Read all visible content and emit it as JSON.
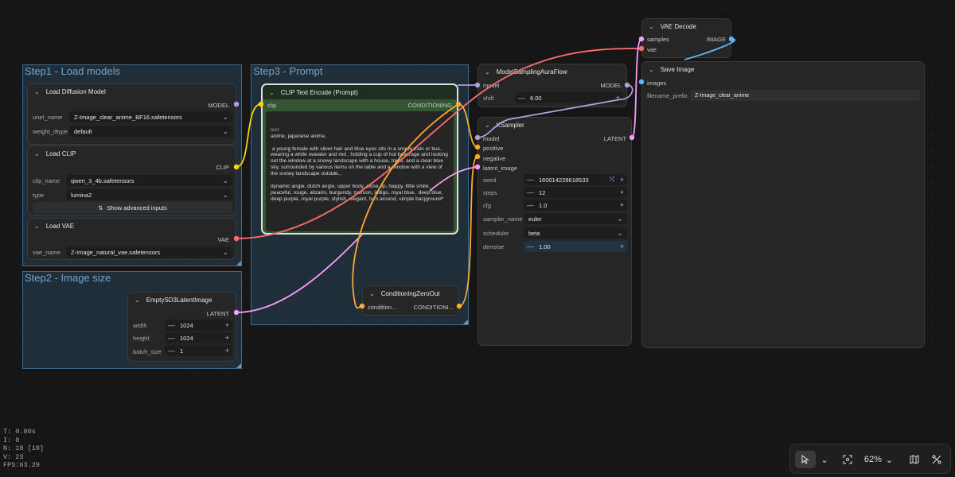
{
  "groups": {
    "step1": "Step1 - Load models",
    "step2": "Step2 - Image size",
    "step3": "Step3 - Prompt"
  },
  "load_diffusion": {
    "title": "Load Diffusion Model",
    "output": "MODEL",
    "unet_label": "unet_name",
    "unet_value": "Z-Image_clear_anime_BF16.safetensors",
    "dtype_label": "weight_dtype",
    "dtype_value": "default"
  },
  "load_clip": {
    "title": "Load CLIP",
    "output": "CLIP",
    "name_label": "clip_name",
    "name_value": "qwen_3_4b.safetensors",
    "type_label": "type",
    "type_value": "lumina2",
    "advanced": "Show advanced inputs"
  },
  "load_vae": {
    "title": "Load VAE",
    "output": "VAE",
    "name_label": "vae_name",
    "name_value": "Z-Image_natural_vae.safetensors"
  },
  "empty_latent": {
    "title": "EmptySD3LatentImage",
    "output": "LATENT",
    "width_label": "width",
    "width_value": "1024",
    "height_label": "height",
    "height_value": "1024",
    "batch_label": "batch_size",
    "batch_value": "1"
  },
  "clip_encode": {
    "title": "CLIP Text Encode (Prompt)",
    "input": "clip",
    "output": "CONDITIONING",
    "text_label": "text",
    "text": "anime, japanese anime,\n\n a young female with silver hair and blue eyes sits in a snowy train or bus, wearing a white sweater and red , holding a cup of hot beverage and looking out the window at a snowy landscape with a house, trees, and a clear blue sky, surrounded by various items on the table and a window with a view of the snowy landscape outside.,\n\ndynamic angle, dutch angle, upper body, close up, happy, little smile, peaceful, rouge, alizarin, burgundy, maroon, indigo, royal blue,  deep blue, deep purple, royal purple, stylish, elegant, turn around, simple bacjground*"
  },
  "cond_zero": {
    "title": "ConditioningZeroOut",
    "input": "condition...",
    "output": "CONDITIONI..."
  },
  "model_sampling": {
    "title": "ModelSamplingAuraFlow",
    "input": "model",
    "output": "MODEL",
    "shift_label": "shift",
    "shift_value": "6.00"
  },
  "ksampler": {
    "title": "KSampler",
    "inputs": [
      "model",
      "positive",
      "negative",
      "latent_image"
    ],
    "output": "LATENT",
    "seed_label": "seed",
    "seed_value": "160014228618533",
    "steps_label": "steps",
    "steps_value": "12",
    "cfg_label": "cfg",
    "cfg_value": "1.0",
    "sampler_label": "sampler_name",
    "sampler_value": "euler",
    "scheduler_label": "scheduler",
    "scheduler_value": "beta",
    "denoise_label": "denoise",
    "denoise_value": "1.00"
  },
  "vae_decode": {
    "title": "VAE Decode",
    "inputs": [
      "samples",
      "vae"
    ],
    "output": "IMAGE"
  },
  "save_image": {
    "title": "Save Image",
    "input": "images",
    "prefix_label": "filename_prefix",
    "prefix_value": "Z-Image_clear_anime"
  },
  "stats": {
    "t": "T: 0.00s",
    "i": "I: 0",
    "n": "N: 10 [10]",
    "v": "V: 23",
    "fps": "FPS:63.29"
  },
  "toolbar": {
    "zoom": "62%"
  },
  "icons": {
    "collapse": "chevron-down-icon",
    "select": "pointer-icon",
    "fit": "fit-view-icon",
    "minimap": "map-icon",
    "links": "link-toggle-icon"
  },
  "colors": {
    "model": "#b39ddb",
    "clip": "#ffd500",
    "vae": "#ff6e6e",
    "conditioning": "#ffa931",
    "latent": "#ff9cf9",
    "image": "#64b5f6",
    "group": "#3b6a8e",
    "prompt_node": "#335533"
  }
}
